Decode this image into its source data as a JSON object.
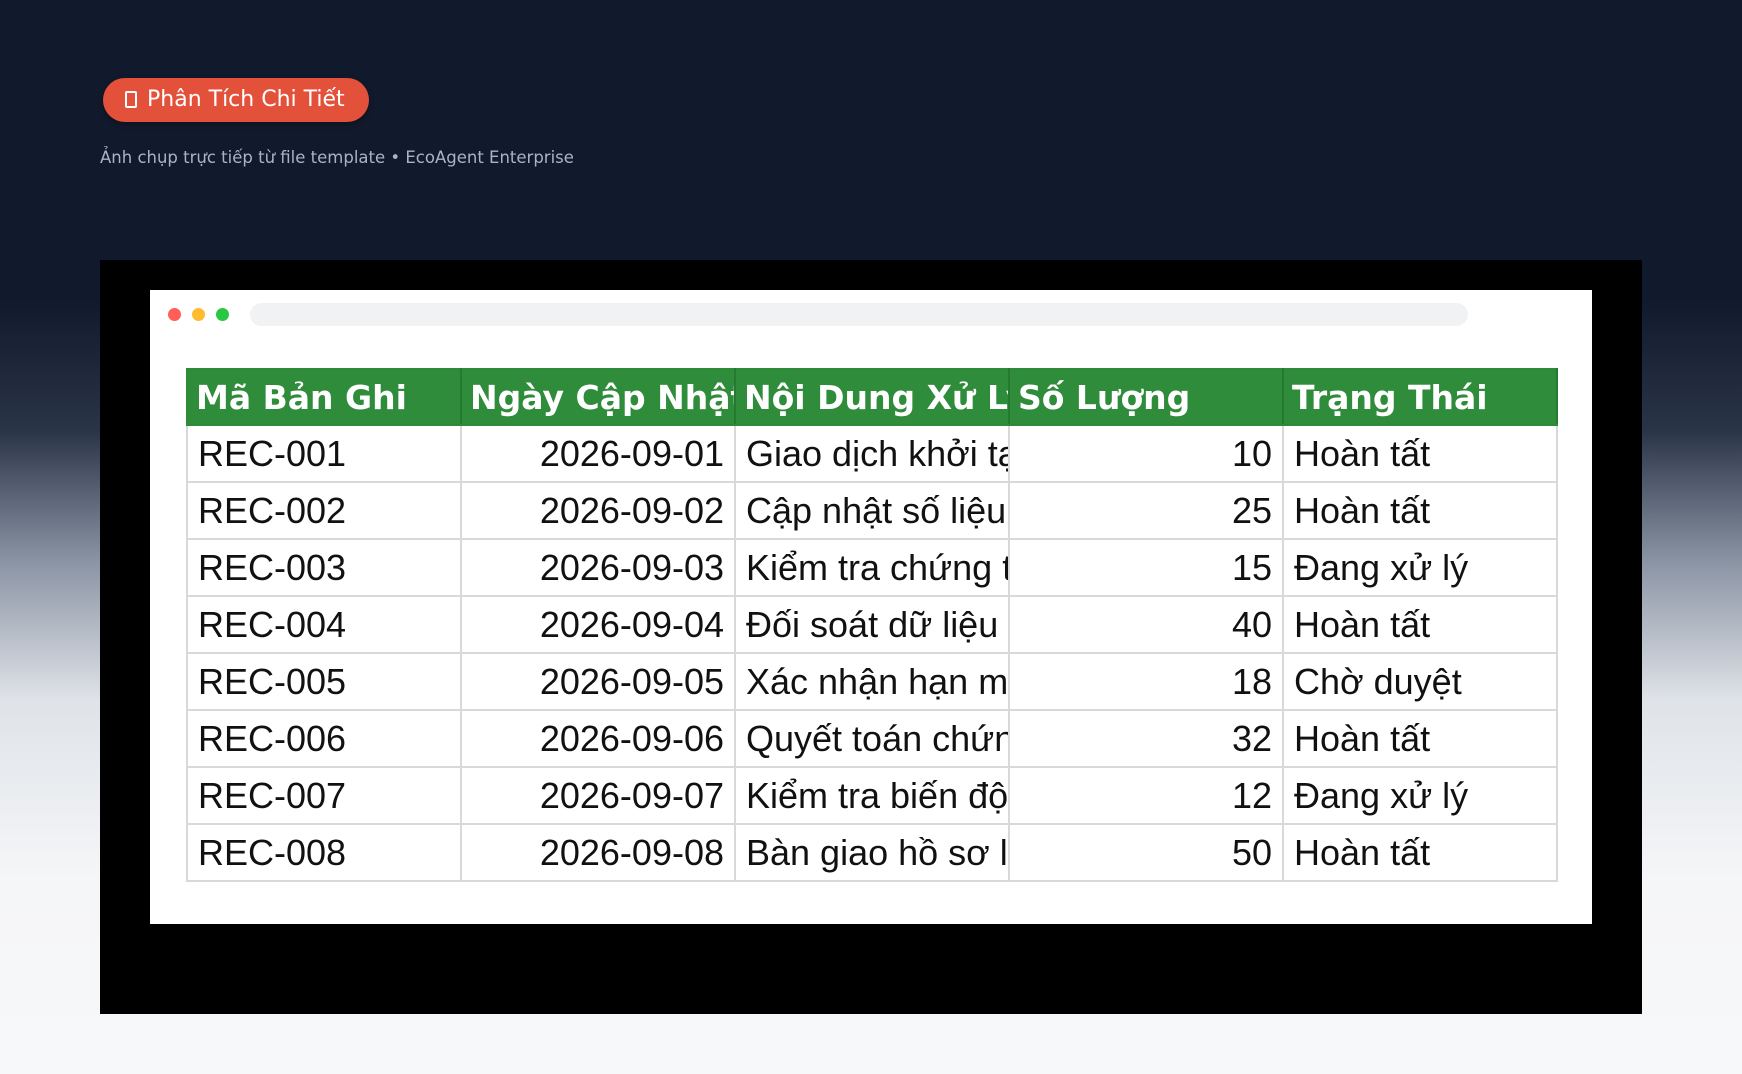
{
  "header": {
    "badge_label": "Phân Tích Chi Tiết",
    "badge_color": "#e4513a",
    "subtitle": "Ảnh chụp trực tiếp từ file template • EcoAgent Enterprise"
  },
  "sheet": {
    "header_color": "#2f8c3a",
    "columns": [
      "Mã Bản Ghi",
      "Ngày Cập Nhật",
      "Nội Dung Xử Lý",
      "Số Lượng",
      "Trạng Thái"
    ],
    "rows": [
      {
        "id": "REC-001",
        "date": "2026-09-01",
        "content": "Giao dịch khởi tạ",
        "qty": "10",
        "status": "Hoàn tất"
      },
      {
        "id": "REC-002",
        "date": "2026-09-02",
        "content": "Cập nhật số liệu",
        "qty": "25",
        "status": "Hoàn tất"
      },
      {
        "id": "REC-003",
        "date": "2026-09-03",
        "content": "Kiểm tra chứng t",
        "qty": "15",
        "status": "Đang xử lý"
      },
      {
        "id": "REC-004",
        "date": "2026-09-04",
        "content": "Đối soát dữ liệu t",
        "qty": "40",
        "status": "Hoàn tất"
      },
      {
        "id": "REC-005",
        "date": "2026-09-05",
        "content": "Xác nhận hạn mu",
        "qty": "18",
        "status": "Chờ duyệt"
      },
      {
        "id": "REC-006",
        "date": "2026-09-06",
        "content": "Quyết toán chứn",
        "qty": "32",
        "status": "Hoàn tất"
      },
      {
        "id": "REC-007",
        "date": "2026-09-07",
        "content": "Kiểm tra biến độ",
        "qty": "12",
        "status": "Đang xử lý"
      },
      {
        "id": "REC-008",
        "date": "2026-09-08",
        "content": "Bàn giao hồ sơ lu",
        "qty": "50",
        "status": "Hoàn tất"
      }
    ]
  }
}
